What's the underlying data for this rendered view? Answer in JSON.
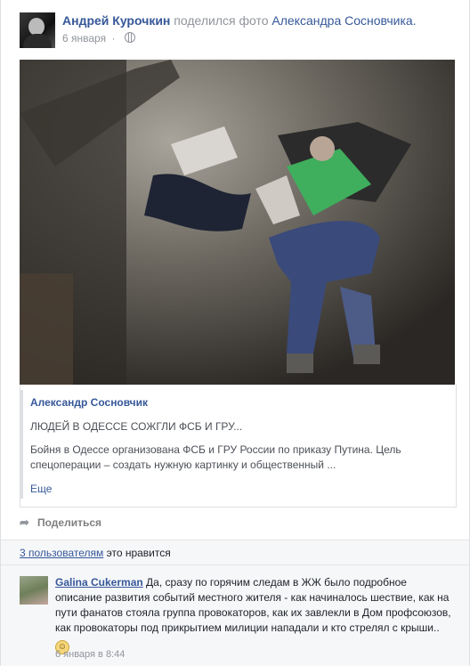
{
  "post": {
    "author": "Андрей Курочкин",
    "action": "поделился фото",
    "source_author": "Александра Сосновчика.",
    "date": "6 января",
    "privacy_icon": "globe-icon"
  },
  "attachment": {
    "name": "Александр Сосновчик",
    "headline": "ЛЮДЕЙ В ОДЕССЕ СОЖГЛИ ФСБ И ГРУ...",
    "text": "Бойня в Одессе организована ФСБ и ГРУ России по приказу Путина. Цель спецоперации – создать нужную картинку и общественный ...",
    "more_label": "Еще"
  },
  "actions": {
    "share_label": "Поделиться",
    "share_icon": "share-arrow-icon"
  },
  "likes": {
    "count_label": "3 пользователям",
    "suffix": "это нравится"
  },
  "comment": {
    "author": "Galina Cukerman",
    "text": "Да, сразу по горячим следам в ЖЖ было подробное описание развития событий местного жителя - как начиналось шествие, как на пути фанатов стояла группа провокаторов, как их завлекли в Дом профсоюзов, как провокаторы под прикрытием милиции нападали и кто стрелял с крыши..",
    "emoji": "smile-icon",
    "time": "6 января в 8:44"
  }
}
